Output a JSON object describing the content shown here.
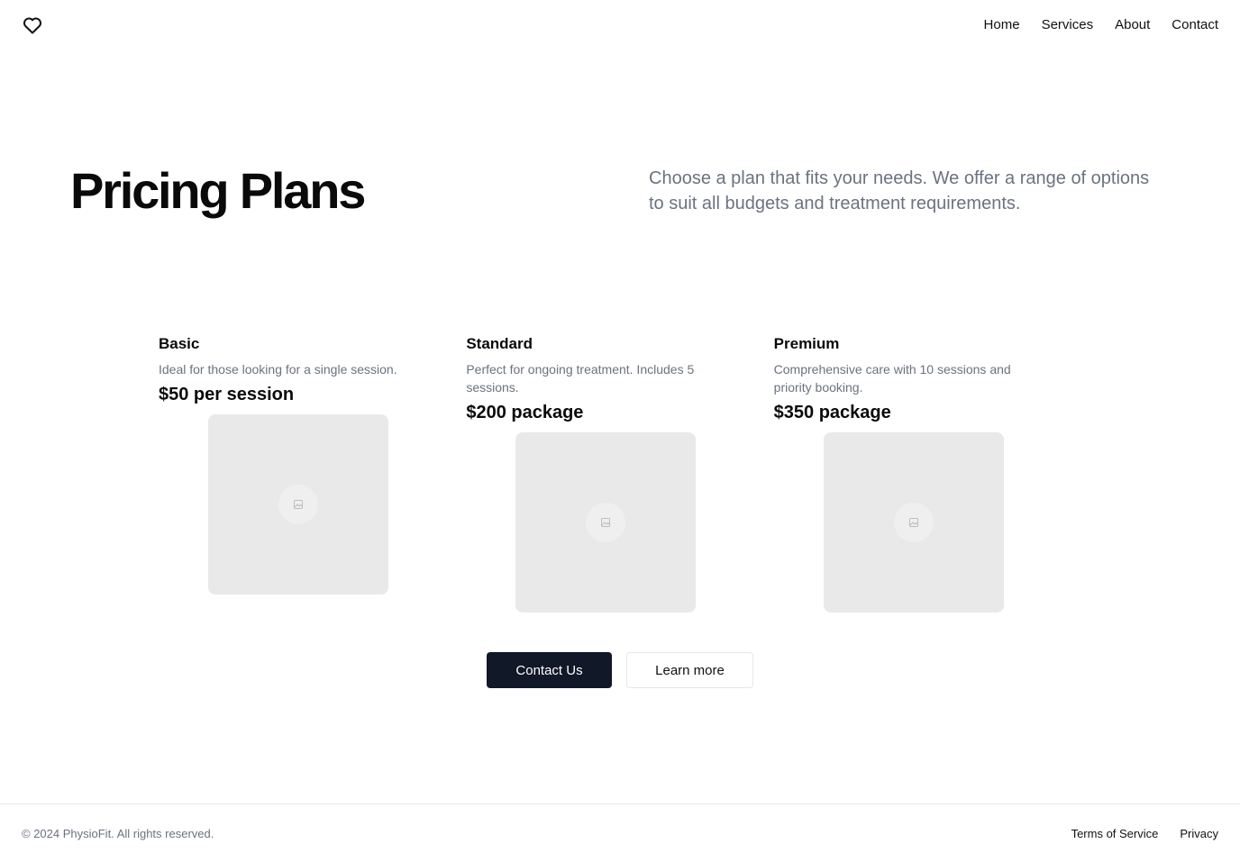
{
  "header": {
    "logo_icon": "heart-icon",
    "nav": [
      "Home",
      "Services",
      "About",
      "Contact"
    ]
  },
  "hero": {
    "title": "Pricing Plans",
    "description": "Choose a plan that fits your needs. We offer a range of options to suit all budgets and treatment requirements."
  },
  "plans": [
    {
      "name": "Basic",
      "description": "Ideal for those looking for a single session.",
      "price": "$50 per session",
      "image_icon": "image-placeholder-icon"
    },
    {
      "name": "Standard",
      "description": "Perfect for ongoing treatment. Includes 5 sessions.",
      "price": "$200 package",
      "image_icon": "image-placeholder-icon"
    },
    {
      "name": "Premium",
      "description": "Comprehensive care with 10 sessions and priority booking.",
      "price": "$350 package",
      "image_icon": "image-placeholder-icon"
    }
  ],
  "cta": {
    "primary_label": "Contact Us",
    "secondary_label": "Learn more"
  },
  "footer": {
    "copyright": "© 2024 PhysioFit. All rights reserved.",
    "links": [
      "Terms of Service",
      "Privacy"
    ]
  },
  "colors": {
    "primary_button": "#111827",
    "muted_text": "#6b7280",
    "placeholder_bg": "#e9e9e9",
    "border": "#e5e7eb"
  }
}
